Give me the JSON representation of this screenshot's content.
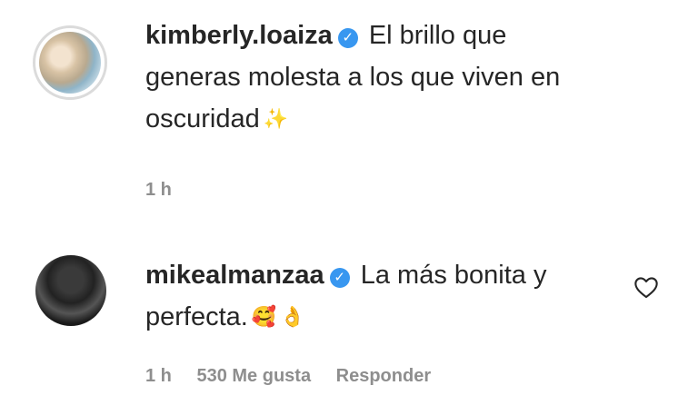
{
  "comments": [
    {
      "username": "kimberly.loaiza",
      "verified_icon": "verified-check-icon",
      "text_line1": " El brillo que",
      "text_line2": "generas molesta a los que viven en",
      "text_line3": "oscuridad",
      "emoji": "✨",
      "time": "1 h"
    },
    {
      "username": "mikealmanzaa",
      "verified_icon": "verified-check-icon",
      "text_line1": " La más bonita y",
      "text_line2": "perfecta.",
      "emoji1": "🥰",
      "emoji2": "👌",
      "time": "1 h",
      "likes": "530 Me gusta",
      "reply": "Responder"
    }
  ],
  "icons": {
    "like": "heart-outline-icon",
    "verified": "verified-check-icon"
  },
  "colors": {
    "text": "#262626",
    "meta": "#8e8e8e",
    "verified": "#3897f0"
  }
}
